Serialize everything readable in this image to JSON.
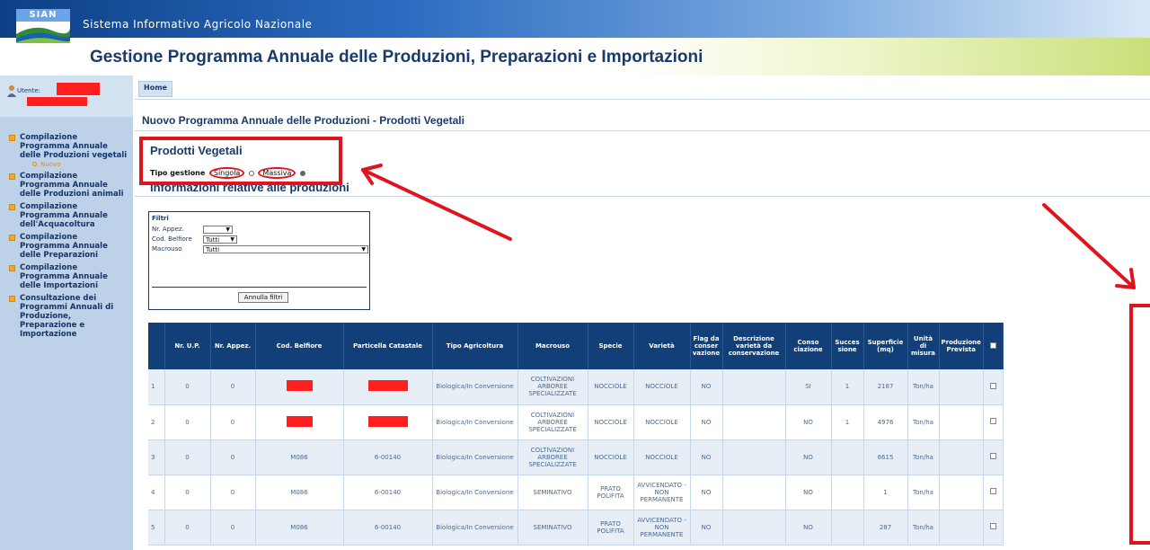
{
  "logo": {
    "tab_text": "SIAN"
  },
  "header": {
    "system_title": "Sistema Informativo Agricolo Nazionale",
    "app_title": "Gestione Programma Annuale delle Produzioni, Preparazioni e Importazioni"
  },
  "user": {
    "label": "Utente:"
  },
  "nav": {
    "items": [
      {
        "label": "Compilazione Programma Annuale delle Produzioni vegetali"
      },
      {
        "label": "Compilazione Programma Annuale delle Produzioni animali"
      },
      {
        "label": "Compilazione Programma Annuale dell'Acquacoltura"
      },
      {
        "label": "Compilazione Programma Annuale delle Preparazioni"
      },
      {
        "label": "Compilazione Programma Annuale delle Importazioni"
      },
      {
        "label": "Consultazione dei Programmi Annuali di Produzione, Preparazione e Importazione"
      }
    ],
    "sub_item": "Nuovo"
  },
  "breadcrumb": {
    "home": "Home"
  },
  "page": {
    "title": "Nuovo Programma Annuale delle Produzioni - Prodotti Vegetali",
    "section": "Prodotti Vegetali",
    "tipo_gestione_label": "Tipo gestione",
    "option_singola": "Singola",
    "option_massiva": "Massiva",
    "info_heading": "Informazioni relative alle produzioni"
  },
  "filters": {
    "title": "Filtri",
    "nr_appez_label": "Nr. Appez.",
    "nr_appez_value": "",
    "cod_belfiore_label": "Cod. Belfiore",
    "cod_belfiore_value": "Tutti",
    "macrouso_label": "Macrouso",
    "macrouso_value": "Tutti",
    "reset_button": "Annulla filtri"
  },
  "table": {
    "headers": {
      "nr_up": "Nr. U.P.",
      "nr_appez": "Nr. Appez.",
      "cod_belfiore": "Cod. Belfiore",
      "particella": "Particella Catastale",
      "tipo_agricoltura": "Tipo Agricoltura",
      "macrouso": "Macrouso",
      "specie": "Specie",
      "varieta": "Varietà",
      "flag": "Flag da conser vazione",
      "descrizione": "Descrizione varietà da conservazione",
      "consociazione": "Conso ciazione",
      "successione": "Succes sione",
      "superficie": "Superficie (mq)",
      "unita": "Unità di misura",
      "produzione": "Produzione Prevista"
    },
    "rows": [
      {
        "n": "1",
        "nr_up": "0",
        "nr_appez": "0",
        "cod_belfiore": "",
        "particella": "",
        "tipo": "Biologica/In Conversione",
        "macrouso": "COLTIVAZIONI ARBOREE SPECIALIZZATE",
        "specie": "NOCCIOLE",
        "varieta": "NOCCIOLE",
        "flag": "NO",
        "descrizione": "",
        "conso": "SI",
        "succ": "1",
        "superficie": "2187",
        "unita": "Ton/ha",
        "produzione": ""
      },
      {
        "n": "2",
        "nr_up": "0",
        "nr_appez": "0",
        "cod_belfiore": "",
        "particella": "",
        "tipo": "Biologica/In Conversione",
        "macrouso": "COLTIVAZIONI ARBOREE SPECIALIZZATE",
        "specie": "NOCCIOLE",
        "varieta": "NOCCIOLE",
        "flag": "NO",
        "descrizione": "",
        "conso": "NO",
        "succ": "1",
        "superficie": "4976",
        "unita": "Ton/ha",
        "produzione": ""
      },
      {
        "n": "3",
        "nr_up": "0",
        "nr_appez": "0",
        "cod_belfiore": "M086",
        "particella": "6-00140",
        "tipo": "Biologica/In Conversione",
        "macrouso": "COLTIVAZIONI ARBOREE SPECIALIZZATE",
        "specie": "NOCCIOLE",
        "varieta": "NOCCIOLE",
        "flag": "NO",
        "descrizione": "",
        "conso": "NO",
        "succ": "",
        "superficie": "6615",
        "unita": "Ton/ha",
        "produzione": ""
      },
      {
        "n": "4",
        "nr_up": "0",
        "nr_appez": "0",
        "cod_belfiore": "M086",
        "particella": "6-00140",
        "tipo": "Biologica/In Conversione",
        "macrouso": "SEMINATIVO",
        "specie": "PRATO POLIFITA",
        "varieta": "AVVICENDATO - NON PERMANENTE",
        "flag": "NO",
        "descrizione": "",
        "conso": "NO",
        "succ": "",
        "superficie": "1",
        "unita": "Ton/ha",
        "produzione": ""
      },
      {
        "n": "5",
        "nr_up": "0",
        "nr_appez": "0",
        "cod_belfiore": "M086",
        "particella": "6-00140",
        "tipo": "Biologica/In Conversione",
        "macrouso": "SEMINATIVO",
        "specie": "PRATO POLIFITA",
        "varieta": "AVVICENDATO - NON PERMANENTE",
        "flag": "NO",
        "descrizione": "",
        "conso": "NO",
        "succ": "",
        "superficie": "287",
        "unita": "Ton/ha",
        "produzione": ""
      }
    ]
  },
  "colors": {
    "header_blue": "#123f77",
    "annotation_red": "#e0141e",
    "sidebar_bg": "#bdd2e8"
  }
}
